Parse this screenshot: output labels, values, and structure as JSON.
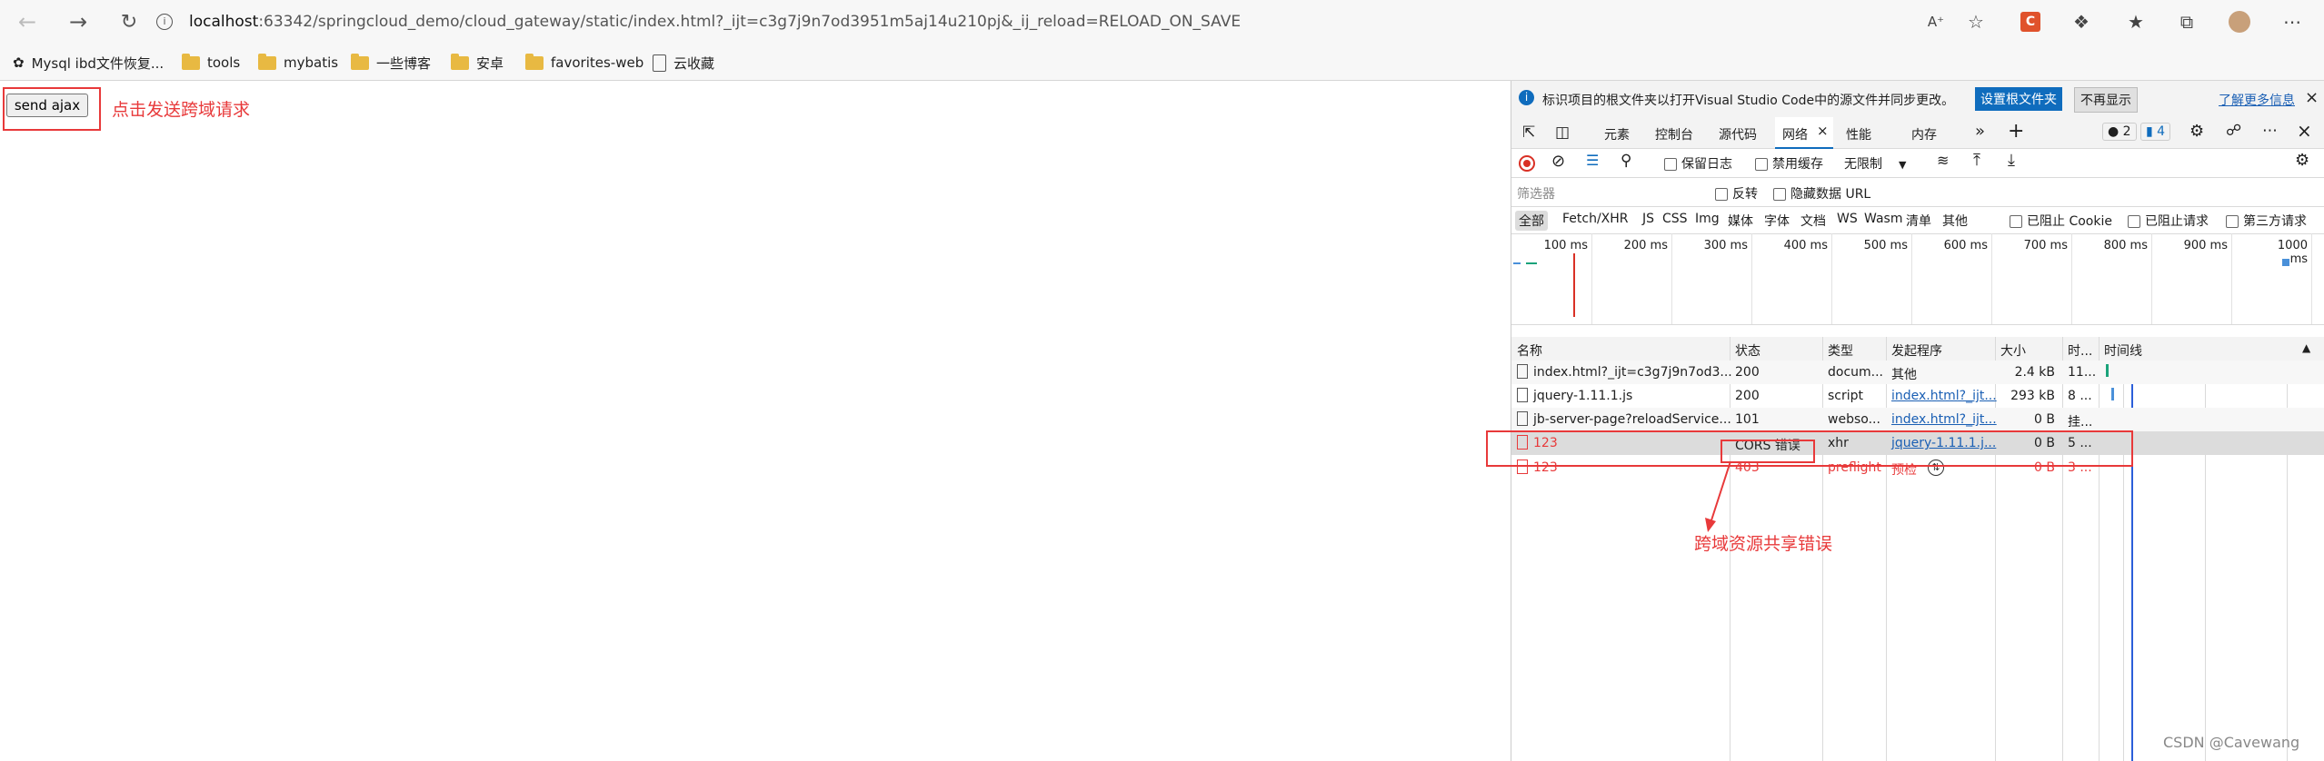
{
  "browser": {
    "url_host": "localhost",
    "url_rest": ":63342/springcloud_demo/cloud_gateway/static/index.html?_ijt=c3g7j9n7od3951m5aj14u210pj&_ij_reload=RELOAD_ON_SAVE",
    "bookmarks": [
      "Mysql ibd文件恢复...",
      "tools",
      "mybatis",
      "一些博客",
      "安卓",
      "favorites-web",
      "云收藏"
    ]
  },
  "page": {
    "button_label": "send ajax",
    "button_note": "点击发送跨域请求"
  },
  "devtools": {
    "infobar_text": "标识项目的根文件夹以打开Visual Studio Code中的源文件并同步更改。",
    "infobar_primary": "设置根文件夹",
    "infobar_secondary": "不再显示",
    "infobar_link": "了解更多信息",
    "tabs": [
      "元素",
      "控制台",
      "源代码",
      "网络",
      "性能",
      "内存"
    ],
    "issue_count": "2",
    "message_count": "4",
    "preserve_log": "保留日志",
    "disable_cache": "禁用缓存",
    "throttle": "无限制",
    "filter_placeholder": "筛选器",
    "invert": "反转",
    "hide_data_urls": "隐藏数据 URL",
    "type_filters": [
      "全部",
      "Fetch/XHR",
      "JS",
      "CSS",
      "Img",
      "媒体",
      "字体",
      "文档",
      "WS",
      "Wasm",
      "清单",
      "其他"
    ],
    "blocked_cookie": "已阻止 Cookie",
    "blocked_request": "已阻止请求",
    "third_party": "第三方请求",
    "timeline_ticks": [
      "100 ms",
      "200 ms",
      "300 ms",
      "400 ms",
      "500 ms",
      "600 ms",
      "700 ms",
      "800 ms",
      "900 ms",
      "1000 ms"
    ],
    "columns": [
      "名称",
      "状态",
      "类型",
      "发起程序",
      "大小",
      "时...",
      "时间线"
    ],
    "rows": [
      {
        "name": "index.html?_ijt=c3g7j9n7od3...",
        "status": "200",
        "type": "docum...",
        "initiator": "其他",
        "size": "2.4 kB",
        "time": "11..."
      },
      {
        "name": "jquery-1.11.1.js",
        "status": "200",
        "type": "script",
        "initiator": "index.html?_ijt...",
        "size": "293 kB",
        "time": "8 ..."
      },
      {
        "name": "jb-server-page?reloadService...",
        "status": "101",
        "type": "webso...",
        "initiator": "index.html?_ijt...",
        "size": "0 B",
        "time": "挂..."
      },
      {
        "name": "123",
        "status": "CORS 错误",
        "type": "xhr",
        "initiator": "jquery-1.11.1.j...",
        "size": "0 B",
        "time": "5 ..."
      },
      {
        "name": "123",
        "status": "403",
        "type": "preflight",
        "initiator": "预检",
        "size": "0 B",
        "time": "3 ..."
      }
    ]
  },
  "annotation": {
    "cors_note": "跨域资源共享错误"
  },
  "watermark": "CSDN @Cavewang",
  "colors": {
    "error": "#e8393a",
    "link": "#1a5fb4",
    "primary_button": "#0f6cbd"
  }
}
